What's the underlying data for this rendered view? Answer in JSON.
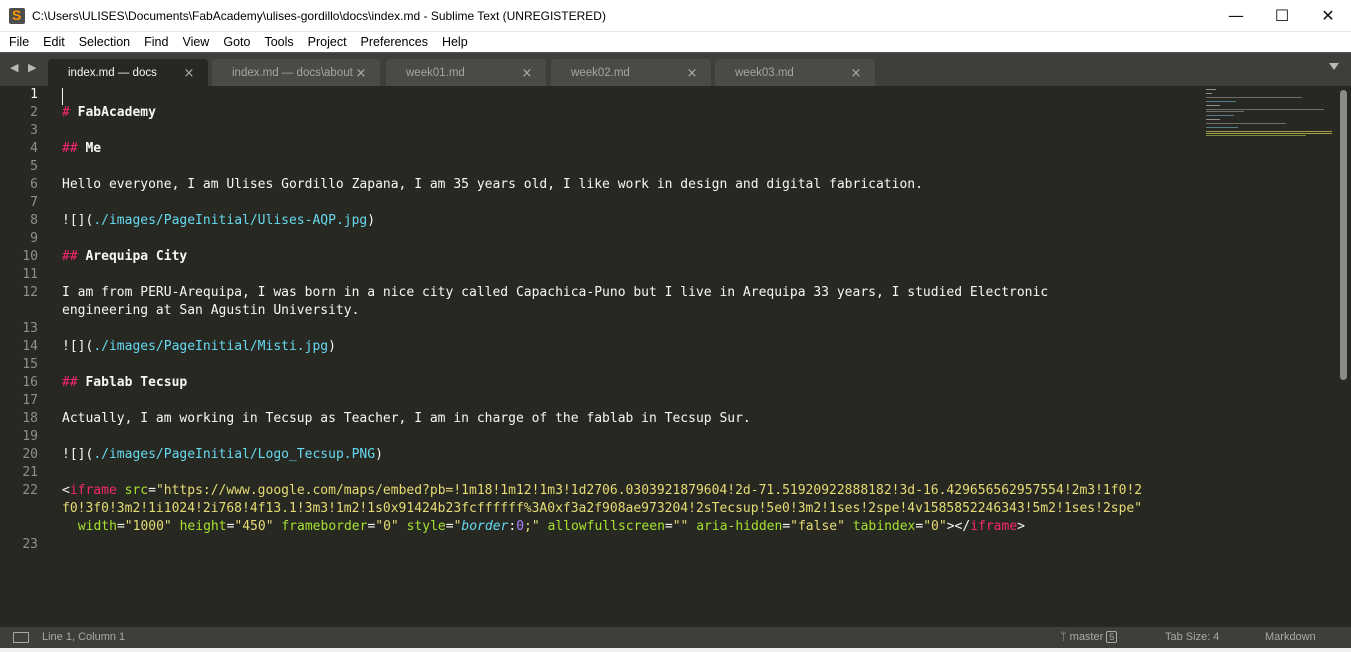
{
  "window": {
    "title": "C:\\Users\\ULISES\\Documents\\FabAcademy\\ulises-gordillo\\docs\\index.md - Sublime Text (UNREGISTERED)",
    "minimize": "—",
    "maximize": "☐",
    "close": "✕"
  },
  "menu": [
    "File",
    "Edit",
    "Selection",
    "Find",
    "View",
    "Goto",
    "Tools",
    "Project",
    "Preferences",
    "Help"
  ],
  "tabs": [
    {
      "label": "index.md — docs",
      "close": "×"
    },
    {
      "label": "index.md — docs\\about",
      "close": "×"
    },
    {
      "label": "week01.md",
      "close": "×"
    },
    {
      "label": "week02.md",
      "close": "×"
    },
    {
      "label": "week03.md",
      "close": "×"
    }
  ],
  "nav_arrows": "◀ ▶",
  "gutter": [
    "1",
    "2",
    "3",
    "4",
    "5",
    "6",
    "7",
    "8",
    "9",
    "10",
    "11",
    "12",
    "13",
    "14",
    "15",
    "16",
    "17",
    "18",
    "19",
    "20",
    "21",
    "22",
    "23"
  ],
  "code": {
    "l2_hash": "# ",
    "l2_text": "FabAcademy",
    "l4_hash": "## ",
    "l4_text": "Me",
    "l6": "Hello everyone, I am Ulises Gordillo Zapana, I am 35 years old, I like work in design and digital fabrication.",
    "l8_pre": "![](",
    "l8_link": "./images/PageInitial/Ulises-AQP.jpg",
    "l8_post": ")",
    "l10_hash": "## ",
    "l10_text": "Arequipa City",
    "l12a": "I am from PERU-Arequipa, I was born in a nice city called Capachica-Puno but I live in Arequipa 33 years, I studied Electronic",
    "l12b": "engineering at San Agustin University.",
    "l14_pre": "![](",
    "l14_link": "./images/PageInitial/Misti.jpg",
    "l14_post": ")",
    "l16_hash": "## ",
    "l16_text": "Fablab Tecsup",
    "l18": "Actually, I am working in Tecsup as Teacher, I am in charge of the fablab in Tecsup Sur.",
    "l20_pre": "![](",
    "l20_link": "./images/PageInitial/Logo_Tecsup.PNG",
    "l20_post": ")",
    "l22_lt": "<",
    "l22_tag": "iframe",
    "l22_src_attr": " src",
    "l22_eq": "=",
    "l22_src_val_a": "\"https://www.google.com/maps/embed?pb=!1m18!1m12!1m3!1d2706.0303921879604!2d-71.51920922888182!3d-16.429656562957554!2m3!1f0!2",
    "l22_src_val_b": "f0!3f0!3m2!1i1024!2i768!4f13.1!3m3!1m2!1s0x91424b23fcffffff%3A0xf3a2f908ae973204!2sTecsup!5e0!3m2!1ses!2spe!4v1585852246343!5m2!1ses!2spe\"",
    "l22_width_attr": " width",
    "l22_width_val": "\"1000\"",
    "l22_height_attr": " height",
    "l22_height_val": "\"450\"",
    "l22_fb_attr": " frameborder",
    "l22_fb_val": "\"0\"",
    "l22_style_attr": " style",
    "l22_style_q1": "\"",
    "l22_style_prop": "border",
    "l22_style_colon": ":",
    "l22_style_num": "0",
    "l22_style_q2": ";\"",
    "l22_afs_attr": " allowfullscreen",
    "l22_afs_val": "\"\"",
    "l22_aria_attr": " aria-hidden",
    "l22_aria_val": "\"false\"",
    "l22_tab_attr": " tabindex",
    "l22_tab_val": "\"0\"",
    "l22_gt": ">",
    "l22_close_lt": "</",
    "l22_close_tag": "iframe",
    "l22_close_gt": ">"
  },
  "status": {
    "position": "Line 1, Column 1",
    "branch": "master",
    "branch_count": "5",
    "tab_size": "Tab Size: 4",
    "syntax": "Markdown"
  },
  "colors": {
    "editor_bg": "#272822",
    "pink": "#f92672",
    "cyan": "#66d9ef",
    "green": "#a6e22e",
    "yellow": "#e6db74"
  }
}
